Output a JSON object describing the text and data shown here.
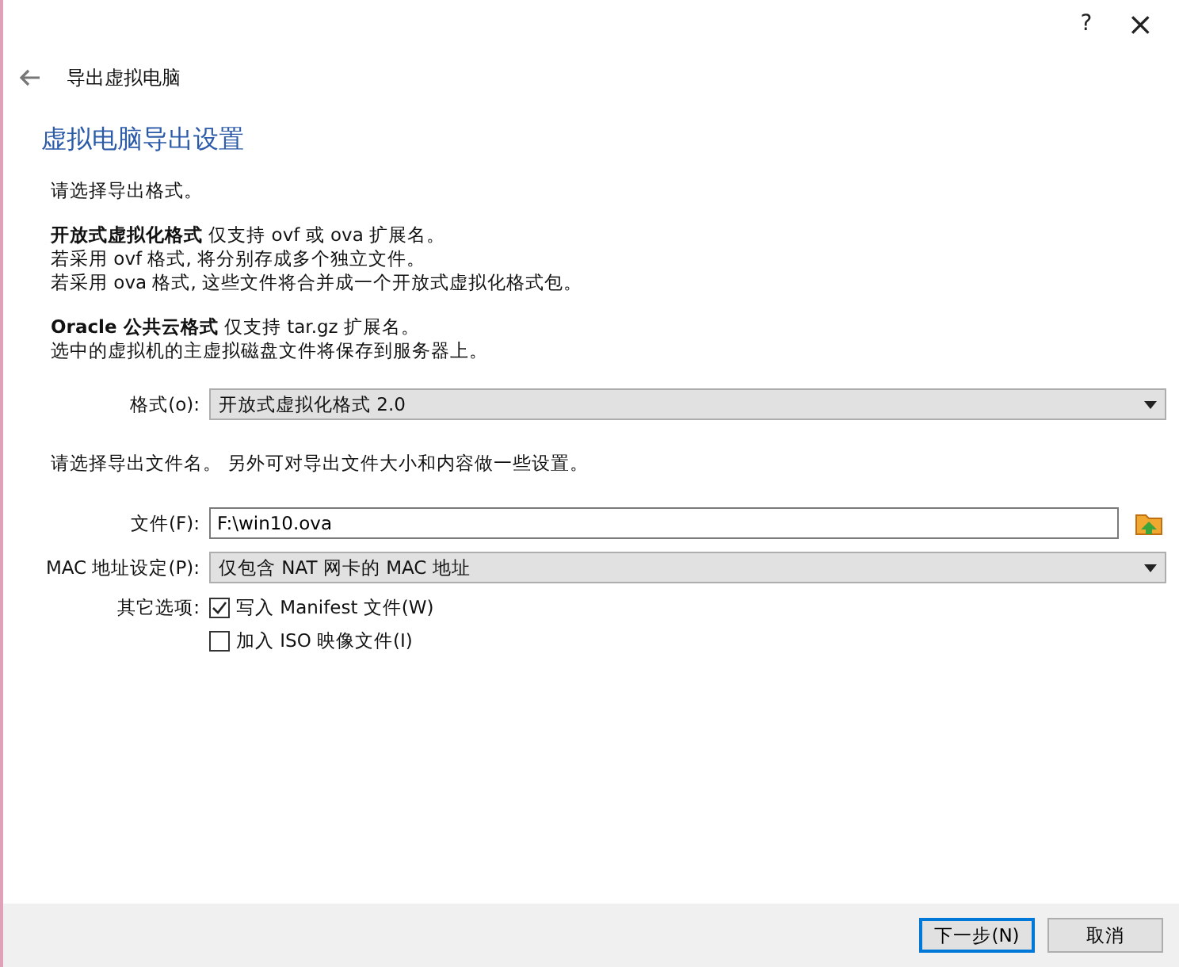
{
  "window": {
    "help": "?",
    "close": "×"
  },
  "header": {
    "title": "导出虚拟电脑"
  },
  "page_title": "虚拟电脑导出设置",
  "intro": "请选择导出格式。",
  "paragraphs": [
    [
      "**开放式虚拟化格式** 仅支持 ovf 或 ova 扩展名。",
      "若采用 ovf 格式, 将分别存成多个独立文件。",
      "若采用 ova 格式, 这些文件将合并成一个开放式虚拟化格式包。"
    ],
    [
      "**Oracle 公共云格式** 仅支持 tar.gz 扩展名。",
      "选中的虚拟机的主虚拟磁盘文件将保存到服务器上。"
    ]
  ],
  "format": {
    "label": "格式(o):",
    "value": "开放式虚拟化格式 2.0"
  },
  "file_hint": "请选择导出文件名。 另外可对导出文件大小和内容做一些设置。",
  "file": {
    "label": "文件(F):",
    "value": "F:\\win10.ova"
  },
  "mac": {
    "label": "MAC 地址设定(P):",
    "value": "仅包含 NAT 网卡的 MAC 地址"
  },
  "options": {
    "label": "其它选项:",
    "items": [
      {
        "label": "写入 Manifest 文件(W)",
        "checked": true
      },
      {
        "label": "加入 ISO 映像文件(I)",
        "checked": false
      }
    ]
  },
  "buttons": [
    {
      "label": "下一步(N)",
      "default": true
    },
    {
      "label": "取消",
      "default": false
    }
  ]
}
